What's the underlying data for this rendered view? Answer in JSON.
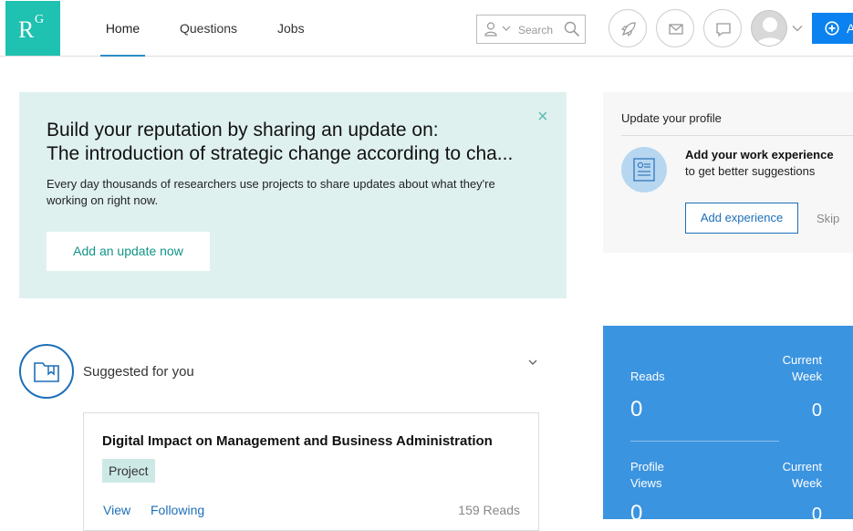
{
  "header": {
    "logo_r": "R",
    "logo_g": "G",
    "nav": [
      "Home",
      "Questions",
      "Jobs"
    ],
    "search_placeholder": "Search",
    "add_button_label": "A"
  },
  "banner": {
    "heading_line1": "Build your reputation by sharing an update on:",
    "heading_line2": "The introduction of strategic change according to cha...",
    "description": "Every day thousands of researchers use projects to share updates about what they're working on right now.",
    "button_label": "Add an update now",
    "close_glyph": "×"
  },
  "suggested": {
    "title": "Suggested for you",
    "card": {
      "title": "Digital Impact on Management and Business Administration",
      "tag": "Project",
      "view_label": "View",
      "following_label": "Following",
      "reads": "159 Reads"
    }
  },
  "profile": {
    "heading": "Update your profile",
    "line1": "Add your work experience",
    "line2": "to get better suggestions",
    "button_label": "Add experience",
    "skip_label": "Skip"
  },
  "stats": {
    "reads_label": "Reads",
    "reads_value": "0",
    "reads_week_label": "Current\nWeek",
    "reads_week_value": "0",
    "views_label": "Profile\nViews",
    "views_value": "0",
    "views_week_label": "Current\nWeek",
    "views_week_value": "0"
  },
  "colors": {
    "brand": "#1fc1b0",
    "primary": "#0b82f0",
    "link": "#1d6fb8",
    "banner_bg": "#dff1ef",
    "stats_bg": "#3b94e0"
  },
  "icons": [
    "search-icon",
    "person-icon",
    "rocket-icon",
    "mail-icon",
    "chat-icon",
    "avatar",
    "plus-icon",
    "close-icon",
    "bookmark-folder-icon",
    "document-icon",
    "chevron-down-icon"
  ]
}
